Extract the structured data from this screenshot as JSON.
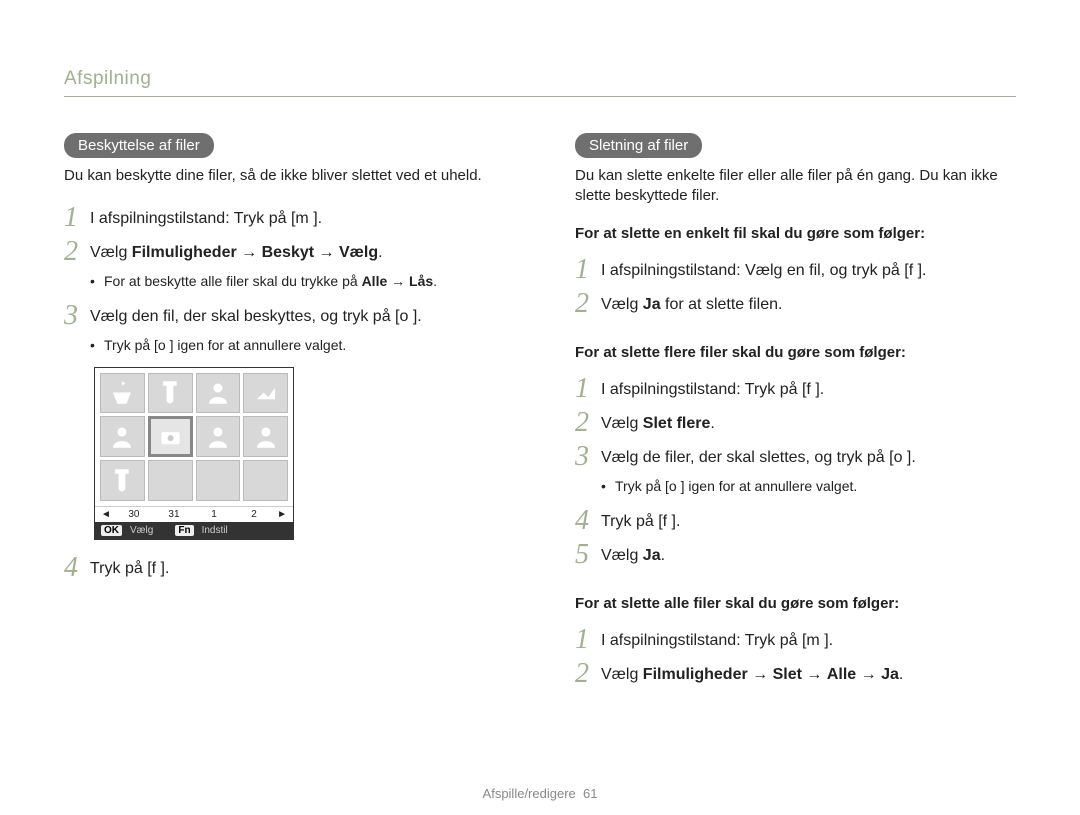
{
  "header": "Afspilning",
  "footer": {
    "section": "Afspille/redigere",
    "page": "61"
  },
  "left": {
    "pill": "Beskyttelse af filer",
    "intro": "Du kan beskytte dine filer, så de ikke bliver slettet ved et uheld.",
    "s1": "I afspilningstilstand: Tryk på [m    ].",
    "s2_pre": "Vælg ",
    "s2_b1": "Filmuligheder",
    "s2_mid1": " → ",
    "s2_b2": "Beskyt",
    "s2_mid2": " → ",
    "s2_b3": "Vælg",
    "s2_post": ".",
    "bul2_pre": "For at beskytte alle filer skal du trykke på ",
    "bul2_b1": "Alle",
    "bul2_mid": " → ",
    "bul2_b2": "Lås",
    "bul2_post": ".",
    "s3": "Vælg den fil, der skal beskyttes, og tryk på [o   ].",
    "bul3": "Tryk på [o   ] igen for at annullere valget.",
    "s4": "Tryk på [f    ].",
    "fig": {
      "dates": [
        "30",
        "31",
        "1",
        "2"
      ],
      "ok": "OK",
      "okLabel": "Vælg",
      "fn": "Fn",
      "fnLabel": "Indstil"
    }
  },
  "right": {
    "pill": "Sletning af filer",
    "intro": "Du kan slette enkelte filer eller alle filer på én gang. Du kan ikke slette beskyttede filer.",
    "subA": "For at slette en enkelt fil skal du gøre som følger:",
    "a1": "I afspilningstilstand: Vælg en fil, og tryk på [f    ].",
    "a2_pre": "Vælg ",
    "a2_b": "Ja",
    "a2_post": " for at slette filen.",
    "subB": "For at slette flere filer skal du gøre som følger:",
    "b1": "I afspilningstilstand: Tryk på [f    ].",
    "b2_pre": "Vælg ",
    "b2_b": "Slet flere",
    "b2_post": ".",
    "b3": "Vælg de filer, der skal slettes, og tryk på [o   ].",
    "b3_bul": "Tryk på [o   ] igen for at annullere valget.",
    "b4": "Tryk på [f    ].",
    "b5_pre": "Vælg ",
    "b5_b": "Ja",
    "b5_post": ".",
    "subC": "For at slette alle filer skal du gøre som følger:",
    "c1": "I afspilningstilstand: Tryk på [m    ].",
    "c2_pre": "Vælg ",
    "c2_b1": "Filmuligheder",
    "c2_m1": " → ",
    "c2_b2": "Slet",
    "c2_m2": " → ",
    "c2_b3": "Alle",
    "c2_m3": " → ",
    "c2_b4": "Ja",
    "c2_post": "."
  }
}
